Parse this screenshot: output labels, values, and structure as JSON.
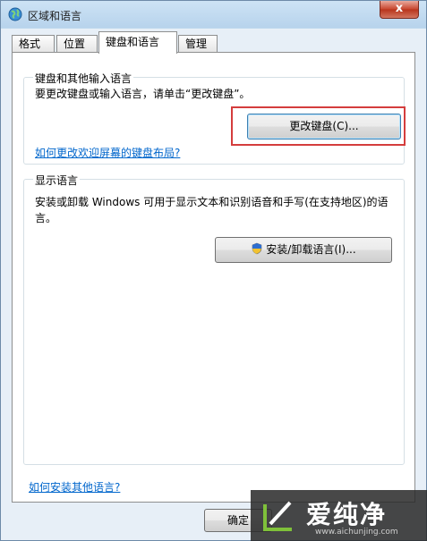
{
  "window": {
    "title": "区域和语言",
    "close_label": "x"
  },
  "tabs": [
    {
      "label": "格式"
    },
    {
      "label": "位置"
    },
    {
      "label": "键盘和语言",
      "active": true
    },
    {
      "label": "管理"
    }
  ],
  "keyboard_group": {
    "title": "键盘和其他输入语言",
    "description": "要更改键盘或输入语言，请单击“更改键盘”。",
    "change_button": "更改键盘(C)...",
    "link": "如何更改欢迎屏幕的键盘布局?"
  },
  "display_group": {
    "title": "显示语言",
    "description_line1": "安装或卸载 Windows 可用于显示文本和识别语音和手写(在支持地区)的语",
    "description_line2": "言。",
    "install_button": "安装/卸载语言(I)..."
  },
  "footer": {
    "link": "如何安装其他语言?",
    "ok_button": "确定"
  },
  "watermark": {
    "text": "爱纯净",
    "url": "www.aichunjing.com"
  },
  "colors": {
    "highlight": "#d43d3d",
    "link": "#0066cc",
    "accent": "#3c7fb1"
  }
}
